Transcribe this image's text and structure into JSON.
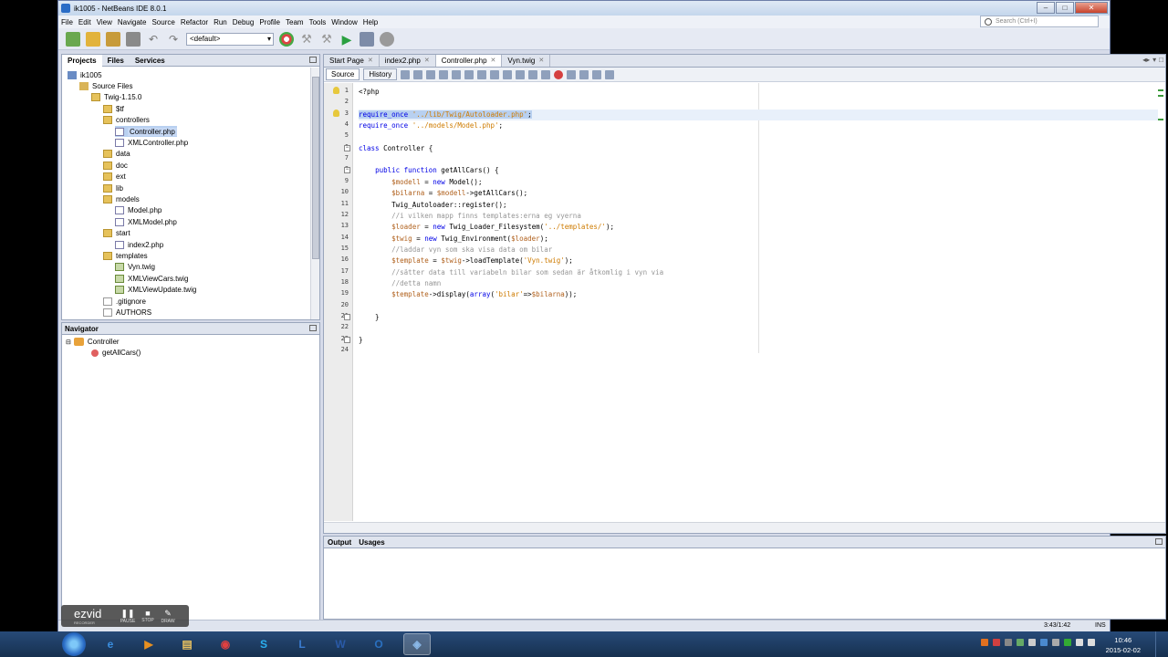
{
  "window": {
    "title": "ik1005 - NetBeans IDE 8.0.1"
  },
  "menu": [
    "File",
    "Edit",
    "View",
    "Navigate",
    "Source",
    "Refactor",
    "Run",
    "Debug",
    "Profile",
    "Team",
    "Tools",
    "Window",
    "Help"
  ],
  "search": {
    "placeholder": "Search (Ctrl+I)"
  },
  "toolbar": {
    "config": "<default>"
  },
  "projects_panel": {
    "tabs": [
      "Projects",
      "Files",
      "Services"
    ],
    "tree": [
      {
        "label": "ik1005",
        "depth": 0,
        "icon": "proj"
      },
      {
        "label": "Source Files",
        "depth": 1,
        "icon": "src"
      },
      {
        "label": "Twig-1.15.0",
        "depth": 2,
        "icon": "folder"
      },
      {
        "label": "$tf",
        "depth": 3,
        "icon": "folder"
      },
      {
        "label": "controllers",
        "depth": 3,
        "icon": "folder"
      },
      {
        "label": "Controller.php",
        "depth": 4,
        "icon": "php",
        "selected": true
      },
      {
        "label": "XMLController.php",
        "depth": 4,
        "icon": "php"
      },
      {
        "label": "data",
        "depth": 3,
        "icon": "folder"
      },
      {
        "label": "doc",
        "depth": 3,
        "icon": "folder"
      },
      {
        "label": "ext",
        "depth": 3,
        "icon": "folder"
      },
      {
        "label": "lib",
        "depth": 3,
        "icon": "folder"
      },
      {
        "label": "models",
        "depth": 3,
        "icon": "folder"
      },
      {
        "label": "Model.php",
        "depth": 4,
        "icon": "php"
      },
      {
        "label": "XMLModel.php",
        "depth": 4,
        "icon": "php"
      },
      {
        "label": "start",
        "depth": 3,
        "icon": "folder"
      },
      {
        "label": "index2.php",
        "depth": 4,
        "icon": "php"
      },
      {
        "label": "templates",
        "depth": 3,
        "icon": "folder"
      },
      {
        "label": "Vyn.twig",
        "depth": 4,
        "icon": "twig"
      },
      {
        "label": "XMLViewCars.twig",
        "depth": 4,
        "icon": "twig"
      },
      {
        "label": "XMLViewUpdate.twig",
        "depth": 4,
        "icon": "twig"
      },
      {
        "label": ".gitignore",
        "depth": 3,
        "icon": "file"
      },
      {
        "label": "AUTHORS",
        "depth": 3,
        "icon": "file"
      }
    ]
  },
  "navigator": {
    "title": "Navigator",
    "class_name": "Controller",
    "method_name": "getAllCars()"
  },
  "editor": {
    "tabs": [
      "Start Page",
      "index2.php",
      "Controller.php",
      "Vyn.twig"
    ],
    "active_tab": "Controller.php",
    "source_label": "Source",
    "history_label": "History",
    "lines": [
      {
        "n": "1",
        "segs": [
          [
            "plain",
            "<?php"
          ]
        ]
      },
      {
        "n": "2",
        "segs": []
      },
      {
        "n": "3",
        "segs": [
          [
            "sel kw",
            "require_once"
          ],
          [
            "sel plain",
            " "
          ],
          [
            "sel str",
            "'../lib/Twig/Autoloader.php'"
          ],
          [
            "sel plain",
            ";"
          ]
        ]
      },
      {
        "n": "4",
        "segs": [
          [
            "kw",
            "require_once"
          ],
          [
            "plain",
            " "
          ],
          [
            "str",
            "'../models/Model.php'"
          ],
          [
            "plain",
            ";"
          ]
        ]
      },
      {
        "n": "5",
        "segs": []
      },
      {
        "n": "6",
        "segs": [
          [
            "kw",
            "class"
          ],
          [
            "plain",
            " Controller {"
          ]
        ]
      },
      {
        "n": "7",
        "segs": []
      },
      {
        "n": "8",
        "segs": [
          [
            "plain",
            "    "
          ],
          [
            "kw",
            "public function"
          ],
          [
            "plain",
            " getAllCars() {"
          ]
        ]
      },
      {
        "n": "9",
        "segs": [
          [
            "plain",
            "        "
          ],
          [
            "var",
            "$modell"
          ],
          [
            "plain",
            " = "
          ],
          [
            "kw",
            "new"
          ],
          [
            "plain",
            " Model();"
          ]
        ]
      },
      {
        "n": "10",
        "segs": [
          [
            "plain",
            "        "
          ],
          [
            "var",
            "$bilarna"
          ],
          [
            "plain",
            " = "
          ],
          [
            "var",
            "$modell"
          ],
          [
            "plain",
            "->getAllCars();"
          ]
        ]
      },
      {
        "n": "11",
        "segs": [
          [
            "plain",
            "        Twig_Autoloader::register();"
          ]
        ]
      },
      {
        "n": "12",
        "segs": [
          [
            "plain",
            "        "
          ],
          [
            "cmt",
            "//i vilken mapp finns templates:erna eg vyerna"
          ]
        ]
      },
      {
        "n": "13",
        "segs": [
          [
            "plain",
            "        "
          ],
          [
            "var",
            "$loader"
          ],
          [
            "plain",
            " = "
          ],
          [
            "kw",
            "new"
          ],
          [
            "plain",
            " Twig_Loader_Filesystem("
          ],
          [
            "str",
            "'../templates/'"
          ],
          [
            "plain",
            ");"
          ]
        ]
      },
      {
        "n": "14",
        "segs": [
          [
            "plain",
            "        "
          ],
          [
            "var",
            "$twig"
          ],
          [
            "plain",
            " = "
          ],
          [
            "kw",
            "new"
          ],
          [
            "plain",
            " Twig_Environment("
          ],
          [
            "var",
            "$loader"
          ],
          [
            "plain",
            ");"
          ]
        ]
      },
      {
        "n": "15",
        "segs": [
          [
            "plain",
            "        "
          ],
          [
            "cmt",
            "//laddar vyn som ska visa data om bilar"
          ]
        ]
      },
      {
        "n": "16",
        "segs": [
          [
            "plain",
            "        "
          ],
          [
            "var",
            "$template"
          ],
          [
            "plain",
            " = "
          ],
          [
            "var",
            "$twig"
          ],
          [
            "plain",
            "->loadTemplate("
          ],
          [
            "str",
            "'Vyn.twig'"
          ],
          [
            "plain",
            ");"
          ]
        ]
      },
      {
        "n": "17",
        "segs": [
          [
            "plain",
            "        "
          ],
          [
            "cmt",
            "//sätter data till variabeln bilar som sedan är åtkomlig i vyn via"
          ]
        ]
      },
      {
        "n": "18",
        "segs": [
          [
            "plain",
            "        "
          ],
          [
            "cmt",
            "//detta namn"
          ]
        ]
      },
      {
        "n": "19",
        "segs": [
          [
            "plain",
            "        "
          ],
          [
            "var",
            "$template"
          ],
          [
            "plain",
            "->display("
          ],
          [
            "kw",
            "array"
          ],
          [
            "plain",
            "("
          ],
          [
            "str",
            "'bilar'"
          ],
          [
            "plain",
            "=>"
          ],
          [
            "var",
            "$bilarna"
          ],
          [
            "plain",
            "));"
          ]
        ]
      },
      {
        "n": "20",
        "segs": []
      },
      {
        "n": "21",
        "segs": [
          [
            "plain",
            "    }"
          ]
        ]
      },
      {
        "n": "22",
        "segs": []
      },
      {
        "n": "23",
        "segs": [
          [
            "plain",
            "}"
          ]
        ]
      },
      {
        "n": "24",
        "segs": []
      }
    ]
  },
  "output_panel": {
    "tabs": [
      "Output",
      "Usages"
    ]
  },
  "status": {
    "position": "3:43/1:42",
    "mode": "INS"
  },
  "ezvid": {
    "logo": "ezvid",
    "sub": "RECORDER",
    "controls": [
      "PAUSE",
      "STOP",
      "DRAW"
    ]
  },
  "taskbar": {
    "time": "10:46",
    "date": "2015-02-02",
    "apps": [
      "IE",
      "Media",
      "Explorer",
      "Chrome",
      "Skype",
      "Lync",
      "Word",
      "Outlook",
      "NetBeans"
    ]
  }
}
